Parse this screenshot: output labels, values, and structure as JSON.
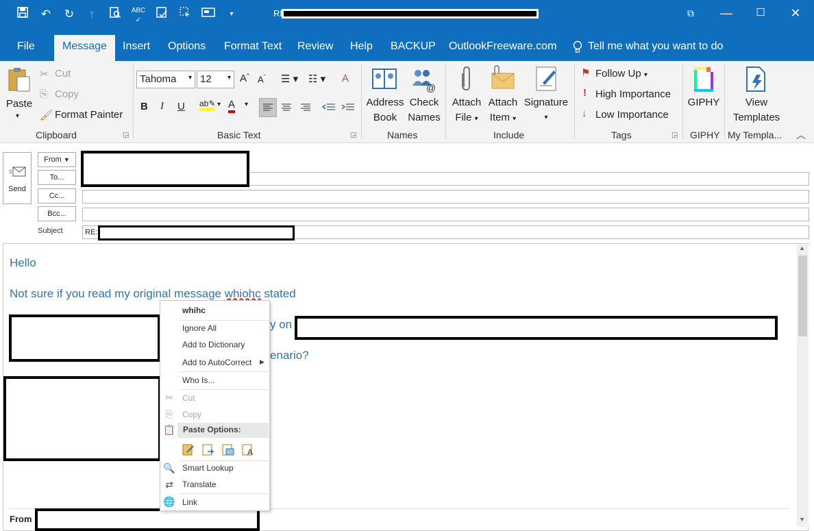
{
  "window": {
    "title_prefix": "RE",
    "controls": {
      "restore": "⧉",
      "maximize": "☐",
      "close": "✕"
    }
  },
  "qat": {
    "items": [
      "save-icon",
      "undo-icon",
      "redo-icon",
      "up-icon",
      "print-preview-icon",
      "spelling-icon",
      "save-as-icon",
      "select-icon",
      "screen-icon",
      "customize-icon"
    ]
  },
  "tabs": [
    "File",
    "Message",
    "Insert",
    "Options",
    "Format Text",
    "Review",
    "Help",
    "BACKUP",
    "OutlookFreeware.com"
  ],
  "tell_me": "Tell me what you want to do",
  "ribbon": {
    "clipboard": {
      "paste": "Paste",
      "cut": "Cut",
      "copy": "Copy",
      "format_painter": "Format Painter",
      "label": "Clipboard"
    },
    "basic_text": {
      "font": "Tahoma",
      "size": "12",
      "label": "Basic Text"
    },
    "names": {
      "address_book_1": "Address",
      "address_book_2": "Book",
      "check_names_1": "Check",
      "check_names_2": "Names",
      "label": "Names"
    },
    "include": {
      "attach_file_1": "Attach",
      "attach_file_2": "File",
      "attach_item_1": "Attach",
      "attach_item_2": "Item",
      "signature": "Signature",
      "label": "Include"
    },
    "tags": {
      "follow_up": "Follow Up",
      "high": "High Importance",
      "low": "Low Importance",
      "label": "Tags"
    },
    "giphy": {
      "button": "GIPHY",
      "label": "GIPHY"
    },
    "templates": {
      "view_1": "View",
      "view_2": "Templates",
      "label": "My Templa..."
    }
  },
  "header": {
    "send": "Send",
    "from": "From",
    "to": "To...",
    "cc": "Cc...",
    "bcc": "Bcc...",
    "subject_label": "Subject",
    "subject_prefix": "RE:"
  },
  "body": {
    "line1": "Hello",
    "line2a": "Not sure if you read my original message ",
    "line2_misspelled": "whiohc",
    "line2b": " stated",
    "line3_fragment": "y on c",
    "line4_fragment": "enario?",
    "from_label": "From"
  },
  "context_menu": {
    "suggestion": "whihc",
    "ignore_all": "Ignore All",
    "add_dictionary": "Add to Dictionary",
    "add_autocorrect": "Add to AutoCorrect",
    "who_is": "Who Is...",
    "cut": "Cut",
    "copy": "Copy",
    "paste_options": "Paste Options:",
    "smart_lookup": "Smart Lookup",
    "translate": "Translate",
    "link": "Link"
  }
}
